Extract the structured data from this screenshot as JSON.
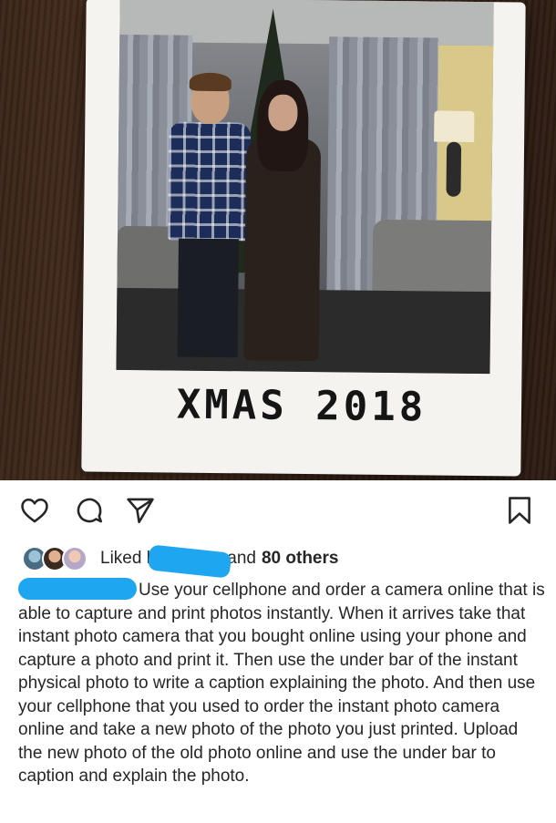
{
  "photo": {
    "handwritten_caption": "XMAS 2018"
  },
  "actions": {
    "like_icon": "heart-icon",
    "comment_icon": "comment-bubble-icon",
    "share_icon": "paper-plane-icon",
    "save_icon": "bookmark-icon"
  },
  "likes": {
    "prefix": "Liked b",
    "suffix": "and",
    "others": "80 others"
  },
  "caption": {
    "text": "Use your cellphone and order a camera online that is able to capture and print photos instantly. When it arrives take that instant photo camera that you bought online using your phone and capture a photo and print it. Then use the under bar of the instant physical photo to write a caption explaining the photo. And then use your cellphone that you used to order the instant photo camera online and take a new photo of the photo you just printed. Upload the new photo of the old photo online and use the under bar to caption and explain the photo."
  },
  "colors": {
    "text": "#262626",
    "redaction": "#1fa6f0",
    "background": "#ffffff"
  }
}
